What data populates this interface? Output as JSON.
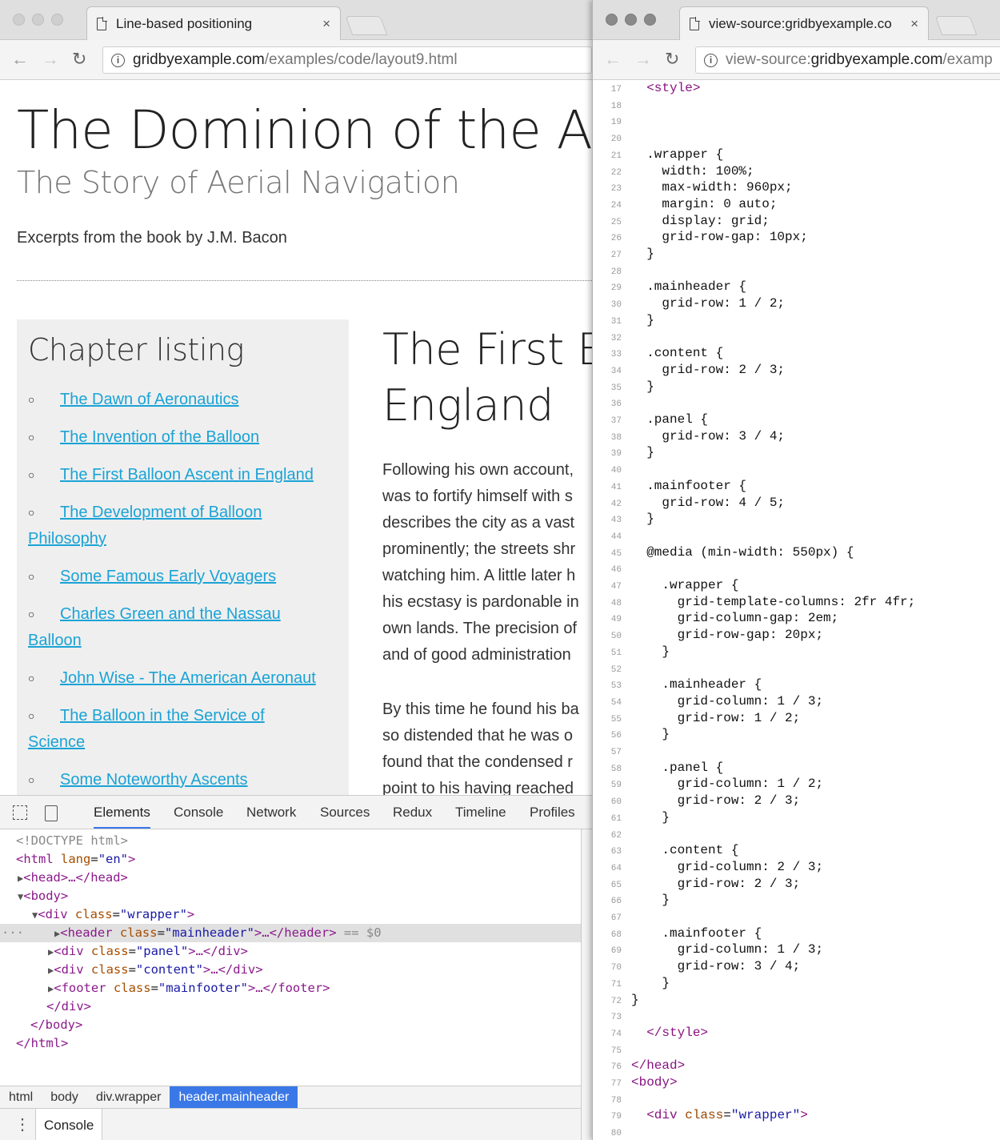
{
  "left_window": {
    "tab_title": "Line-based positioning",
    "tab_close": "×",
    "url_host": "gridbyexample.com",
    "url_path": "/examples/code/layout9.html",
    "page": {
      "title": "The Dominion of the Air",
      "subtitle": "The Story of Aerial Navigation",
      "excerpt": "Excerpts from the book by J.M. Bacon",
      "panel_title": "Chapter listing",
      "chapters": [
        {
          "line1": "The Dawn of Aeronautics",
          "line2": ""
        },
        {
          "line1": "The Invention of the Balloon",
          "line2": ""
        },
        {
          "line1": "The First Balloon Ascent in England",
          "line2": ""
        },
        {
          "line1": "The Development of Balloon",
          "line2": "Philosophy"
        },
        {
          "line1": "Some Famous Early Voyagers",
          "line2": ""
        },
        {
          "line1": "Charles Green and the Nassau",
          "line2": "Balloon"
        },
        {
          "line1": "John Wise - The American Aeronaut",
          "line2": ""
        },
        {
          "line1": "The Balloon in the Service of",
          "line2": "Science"
        },
        {
          "line1": "Some Noteworthy Ascents",
          "line2": ""
        }
      ],
      "content_title_line1": "The First B",
      "content_title_line2": "England",
      "paragraph1": [
        "Following his own account,",
        "was to fortify himself with s",
        "describes the city as a vast",
        "prominently; the streets shr",
        "watching him. A little later h",
        "his ecstasy is pardonable in",
        "own lands. The precision of",
        "and of good administration"
      ],
      "paragraph2": [
        "By this time he found his ba",
        "so distended that he was o",
        "found that the condensed r",
        "point to his having reached"
      ]
    },
    "devtools": {
      "tabs": [
        "Elements",
        "Console",
        "Network",
        "Sources",
        "Redux",
        "Timeline",
        "Profiles"
      ],
      "active_tab": "Elements",
      "dom": {
        "doctype": "<!DOCTYPE html>",
        "html_open": "<html",
        "lang_attr": "lang",
        "lang_val": "\"en\"",
        "head": "<head>…</head>",
        "body_open": "<body>",
        "div_open": "<div",
        "class_attr": "class",
        "wrapper_val": "\"wrapper\"",
        "header_tag": "<header",
        "mainheader_val": "\"mainheader\"",
        "header_close": ">…</header>",
        "selected_marker": "== $0",
        "panel_val": "\"panel\"",
        "div_close_inline": ">…</div>",
        "content_val": "\"content\"",
        "footer_tag": "<footer",
        "mainfooter_val": "\"mainfooter\"",
        "footer_close": ">…</footer>",
        "div_close": "</div>",
        "body_close": "</body>",
        "html_close": "</html>",
        "gt": ">",
        "eq": "=",
        "ellipsis": "···"
      },
      "breadcrumbs": [
        "html",
        "body",
        "div.wrapper",
        "header.mainheader"
      ],
      "drawer_tab": "Console"
    }
  },
  "right_window": {
    "tab_title": "view-source:gridbyexample.co",
    "tab_close": "×",
    "url_prefix": "view-source:",
    "url_host": "gridbyexample.com",
    "url_path": "/examp",
    "source_lines": [
      {
        "n": "17",
        "code": "  <style>"
      },
      {
        "n": "18",
        "code": ""
      },
      {
        "n": "19",
        "code": ""
      },
      {
        "n": "20",
        "code": ""
      },
      {
        "n": "21",
        "code": "  .wrapper {"
      },
      {
        "n": "22",
        "code": "    width: 100%;"
      },
      {
        "n": "23",
        "code": "    max-width: 960px;"
      },
      {
        "n": "24",
        "code": "    margin: 0 auto;"
      },
      {
        "n": "25",
        "code": "    display: grid;"
      },
      {
        "n": "26",
        "code": "    grid-row-gap: 10px;"
      },
      {
        "n": "27",
        "code": "  }"
      },
      {
        "n": "28",
        "code": ""
      },
      {
        "n": "29",
        "code": "  .mainheader {"
      },
      {
        "n": "30",
        "code": "    grid-row: 1 / 2;"
      },
      {
        "n": "31",
        "code": "  }"
      },
      {
        "n": "32",
        "code": ""
      },
      {
        "n": "33",
        "code": "  .content {"
      },
      {
        "n": "34",
        "code": "    grid-row: 2 / 3;"
      },
      {
        "n": "35",
        "code": "  }"
      },
      {
        "n": "36",
        "code": ""
      },
      {
        "n": "37",
        "code": "  .panel {"
      },
      {
        "n": "38",
        "code": "    grid-row: 3 / 4;"
      },
      {
        "n": "39",
        "code": "  }"
      },
      {
        "n": "40",
        "code": ""
      },
      {
        "n": "41",
        "code": "  .mainfooter {"
      },
      {
        "n": "42",
        "code": "    grid-row: 4 / 5;"
      },
      {
        "n": "43",
        "code": "  }"
      },
      {
        "n": "44",
        "code": ""
      },
      {
        "n": "45",
        "code": "  @media (min-width: 550px) {"
      },
      {
        "n": "46",
        "code": ""
      },
      {
        "n": "47",
        "code": "    .wrapper {"
      },
      {
        "n": "48",
        "code": "      grid-template-columns: 2fr 4fr;"
      },
      {
        "n": "49",
        "code": "      grid-column-gap: 2em;"
      },
      {
        "n": "50",
        "code": "      grid-row-gap: 20px;"
      },
      {
        "n": "51",
        "code": "    }"
      },
      {
        "n": "52",
        "code": ""
      },
      {
        "n": "53",
        "code": "    .mainheader {"
      },
      {
        "n": "54",
        "code": "      grid-column: 1 / 3;"
      },
      {
        "n": "55",
        "code": "      grid-row: 1 / 2;"
      },
      {
        "n": "56",
        "code": "    }"
      },
      {
        "n": "57",
        "code": ""
      },
      {
        "n": "58",
        "code": "    .panel {"
      },
      {
        "n": "59",
        "code": "      grid-column: 1 / 2;"
      },
      {
        "n": "60",
        "code": "      grid-row: 2 / 3;"
      },
      {
        "n": "61",
        "code": "    }"
      },
      {
        "n": "62",
        "code": ""
      },
      {
        "n": "63",
        "code": "    .content {"
      },
      {
        "n": "64",
        "code": "      grid-column: 2 / 3;"
      },
      {
        "n": "65",
        "code": "      grid-row: 2 / 3;"
      },
      {
        "n": "66",
        "code": "    }"
      },
      {
        "n": "67",
        "code": ""
      },
      {
        "n": "68",
        "code": "    .mainfooter {"
      },
      {
        "n": "69",
        "code": "      grid-column: 1 / 3;"
      },
      {
        "n": "70",
        "code": "      grid-row: 3 / 4;"
      },
      {
        "n": "71",
        "code": "    }"
      },
      {
        "n": "72",
        "code": "}"
      },
      {
        "n": "73",
        "code": ""
      },
      {
        "n": "74",
        "code": "  </style>"
      },
      {
        "n": "75",
        "code": ""
      },
      {
        "n": "76",
        "code": "</head>"
      },
      {
        "n": "77",
        "code": "<body>"
      },
      {
        "n": "78",
        "code": ""
      },
      {
        "n": "79",
        "code": "  <div class=\"wrapper\">"
      },
      {
        "n": "80",
        "code": ""
      }
    ]
  },
  "colors": {
    "link": "#1aa3d6",
    "panel_bg": "#efefef",
    "devtools_accent": "#3b78e7",
    "tag_purple": "#881280"
  },
  "icons": {
    "back": "back-arrow-icon",
    "forward": "forward-arrow-icon",
    "reload": "reload-icon",
    "info": "info-icon",
    "page": "page-icon",
    "inspect": "inspect-element-icon",
    "device": "device-mode-icon",
    "menu": "kebab-menu-icon"
  }
}
